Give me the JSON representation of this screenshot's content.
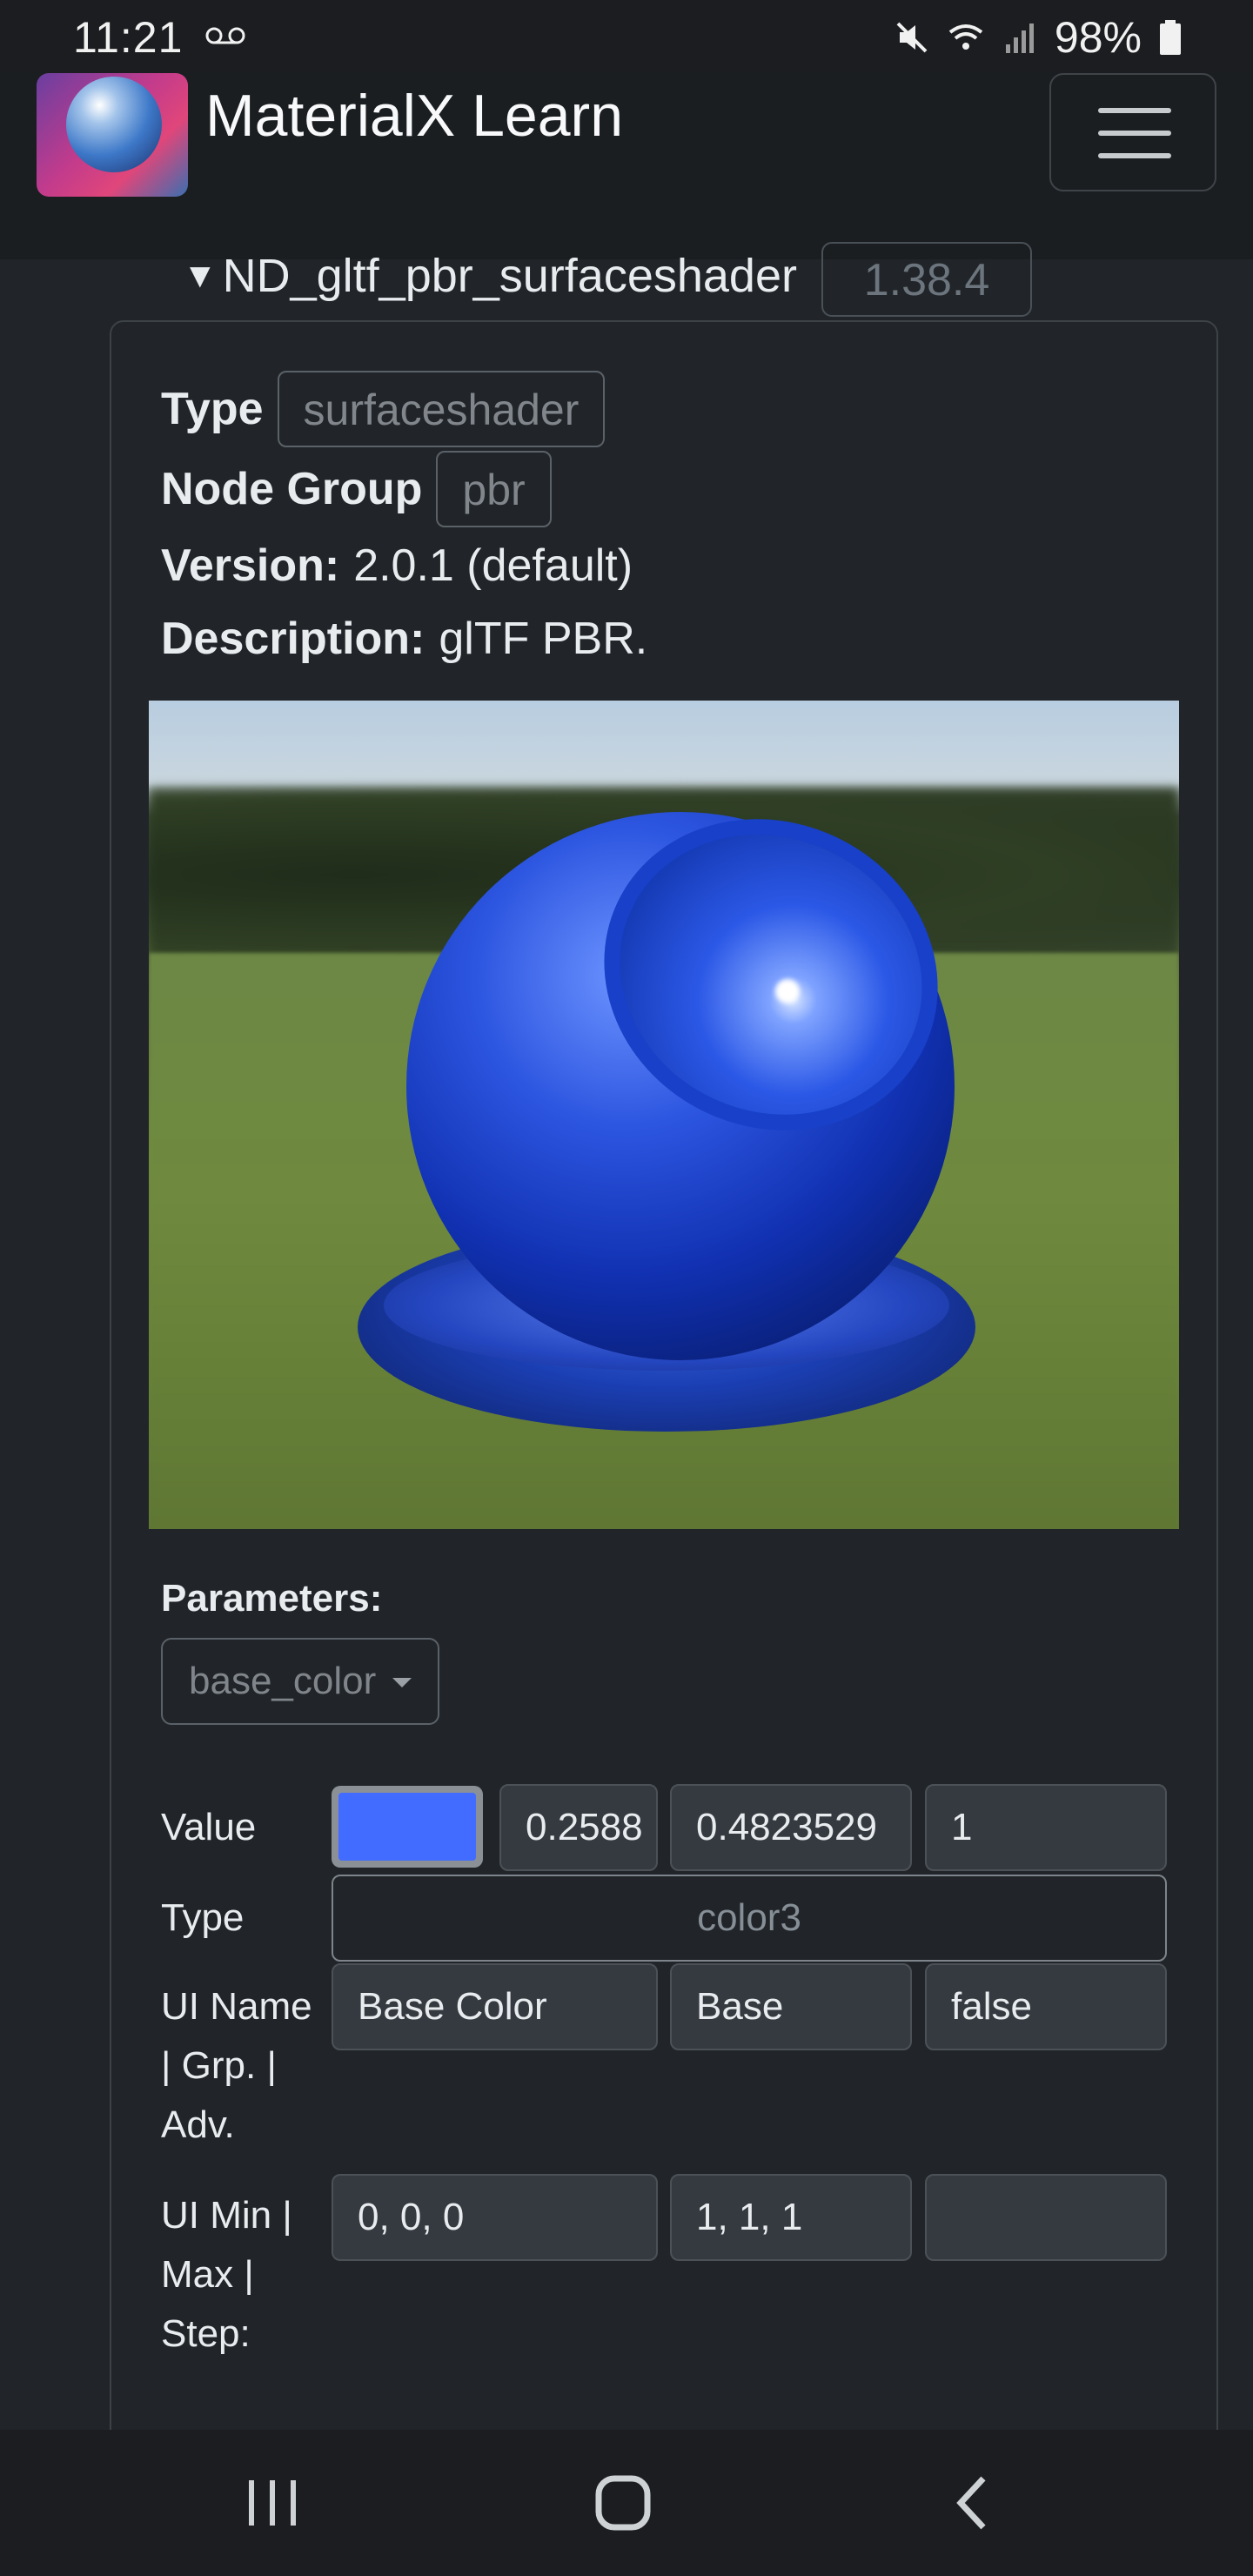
{
  "status_bar": {
    "time": "11:21",
    "battery": "98%"
  },
  "navbar": {
    "brand": "MaterialX Learn"
  },
  "node": {
    "name": "ND_gltf_pbr_surfaceshader",
    "version_badge": "1.38.4",
    "type_label": "Type",
    "type_value": "surfaceshader",
    "group_label": "Node Group",
    "group_value": "pbr",
    "version_label": "Version:",
    "version_value": "2.0.1 (default)",
    "description_label": "Description:",
    "description_value": "glTF PBR."
  },
  "parameters": {
    "label": "Parameters:",
    "selected": "base_color",
    "value_label": "Value",
    "value_color": "#426bff",
    "value_r": "0.2588",
    "value_g": "0.4823529",
    "value_b": "1",
    "type_label": "Type",
    "type_value": "color3",
    "ui_name_label": "UI Name | Grp. | Adv.",
    "ui_name": "Base Color",
    "ui_group": "Base",
    "ui_advanced": "false",
    "ui_range_label": "UI Min | Max | Step:",
    "ui_min": "0, 0, 0",
    "ui_max": "1, 1, 1",
    "ui_step": ""
  },
  "colors": {
    "background": "#212529",
    "accent_swatch": "#426bff"
  }
}
